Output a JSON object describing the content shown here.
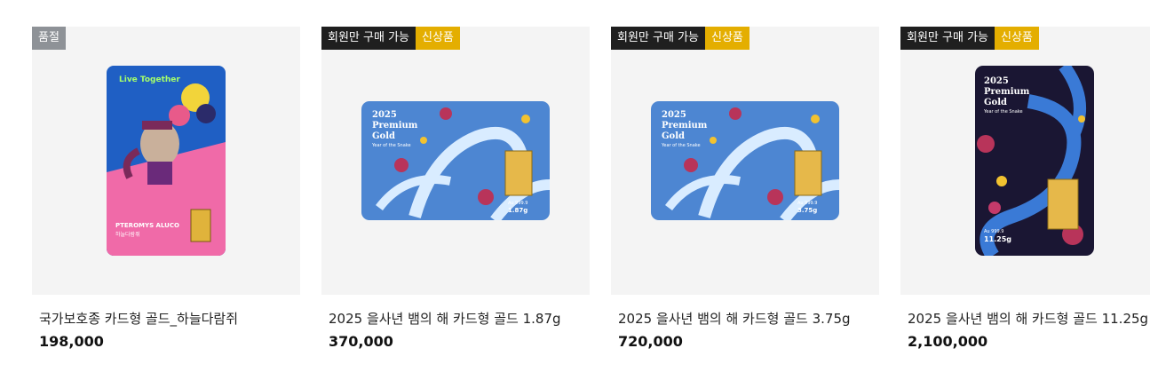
{
  "products": [
    {
      "badges": [
        "품절"
      ],
      "name": "국가보호종 카드형 골드_하늘다람쥐",
      "price": "198,000",
      "card_texts": {
        "title": "Live Together",
        "species": "PTEROMYS ALUCO",
        "kname": "하늘다람쥐"
      }
    },
    {
      "badges": [
        "회원만 구매 가능",
        "신상품"
      ],
      "name": "2025 을사년 뱀의 해 카드형 골드 1.87g",
      "price": "370,000",
      "card_texts": {
        "year": "2025",
        "line1": "Premium",
        "line2": "Gold",
        "line3": "Year of the Snake",
        "purity": "Au 999.9",
        "weight": "1.87g"
      }
    },
    {
      "badges": [
        "회원만 구매 가능",
        "신상품"
      ],
      "name": "2025 을사년 뱀의 해 카드형 골드 3.75g",
      "price": "720,000",
      "card_texts": {
        "year": "2025",
        "line1": "Premium",
        "line2": "Gold",
        "line3": "Year of the Snake",
        "purity": "Au 999.9",
        "weight": "3.75g"
      }
    },
    {
      "badges": [
        "회원만 구매 가능",
        "신상품"
      ],
      "name": "2025 을사년 뱀의 해 카드형 골드 11.25g",
      "price": "2,100,000",
      "card_texts": {
        "year": "2025",
        "line1": "Premium",
        "line2": "Gold",
        "line3": "Year of the Snake",
        "purity": "Au 999.9",
        "weight": "11.25g"
      }
    }
  ],
  "colors": {
    "badge_dark": "#1f1f1f",
    "badge_new": "#e4ae00",
    "badge_soldout": "#8e9297",
    "thumb_bg": "#f4f4f4"
  }
}
